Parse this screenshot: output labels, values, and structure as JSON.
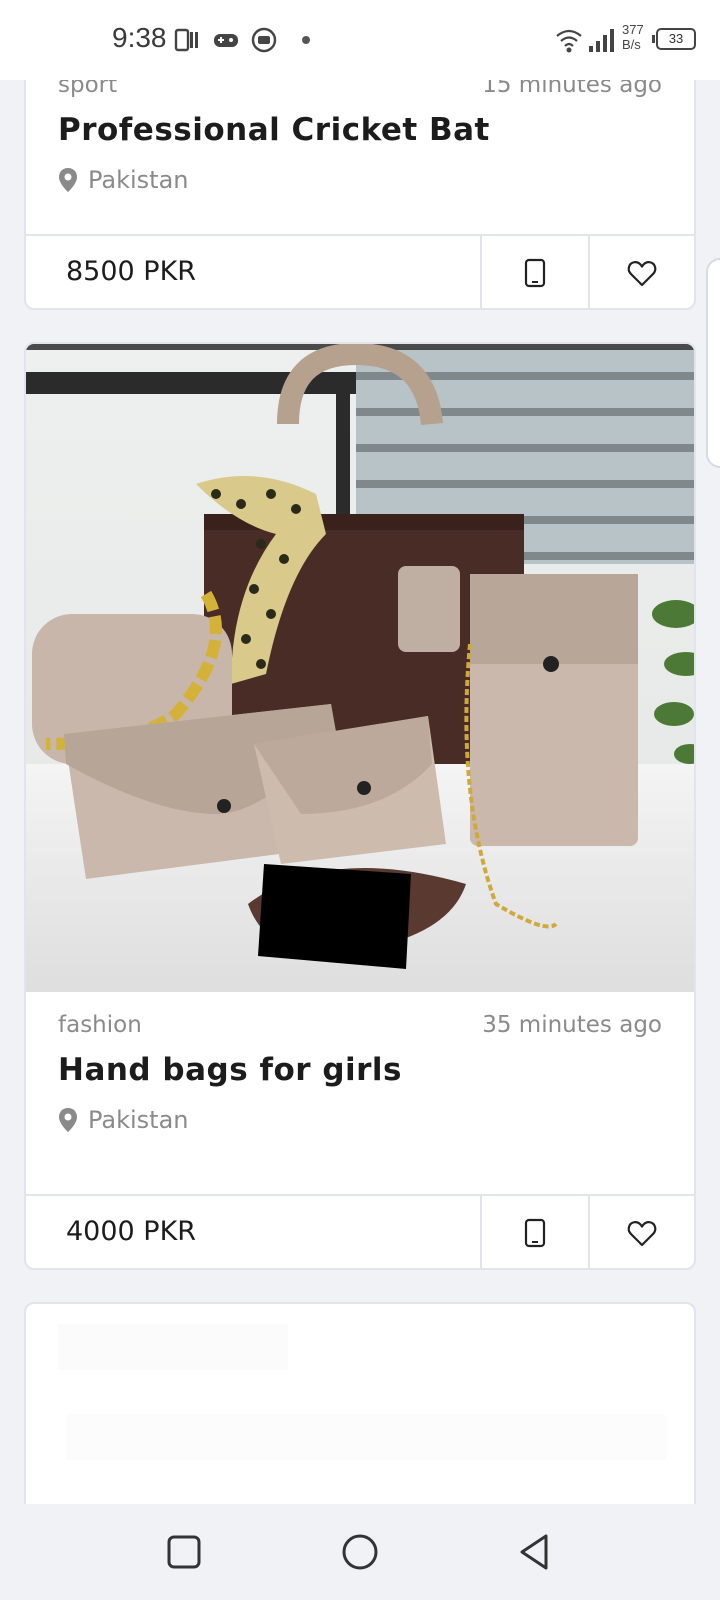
{
  "status_bar": {
    "time": "9:38",
    "net_speed_value": "377",
    "net_speed_unit": "B/s",
    "battery": "33"
  },
  "listings": [
    {
      "category": "sport",
      "posted": "15 minutes ago",
      "title": "Professional Cricket Bat",
      "location": "Pakistan",
      "price": "8500 PKR"
    },
    {
      "category": "fashion",
      "posted": "35 minutes ago",
      "title": "Hand bags for girls",
      "location": "Pakistan",
      "price": "4000 PKR"
    }
  ],
  "icons": {
    "location": "location-pin-icon",
    "call": "phone-icon",
    "favorite": "heart-icon"
  },
  "colors": {
    "background": "#f0f2f6",
    "card": "#ffffff",
    "border": "#e1e4ea",
    "muted_text": "#8a8a8a",
    "title_text": "#1c1c1c"
  },
  "nav": {
    "recents_icon": "square-icon",
    "home_icon": "circle-icon",
    "back_icon": "triangle-back-icon"
  }
}
